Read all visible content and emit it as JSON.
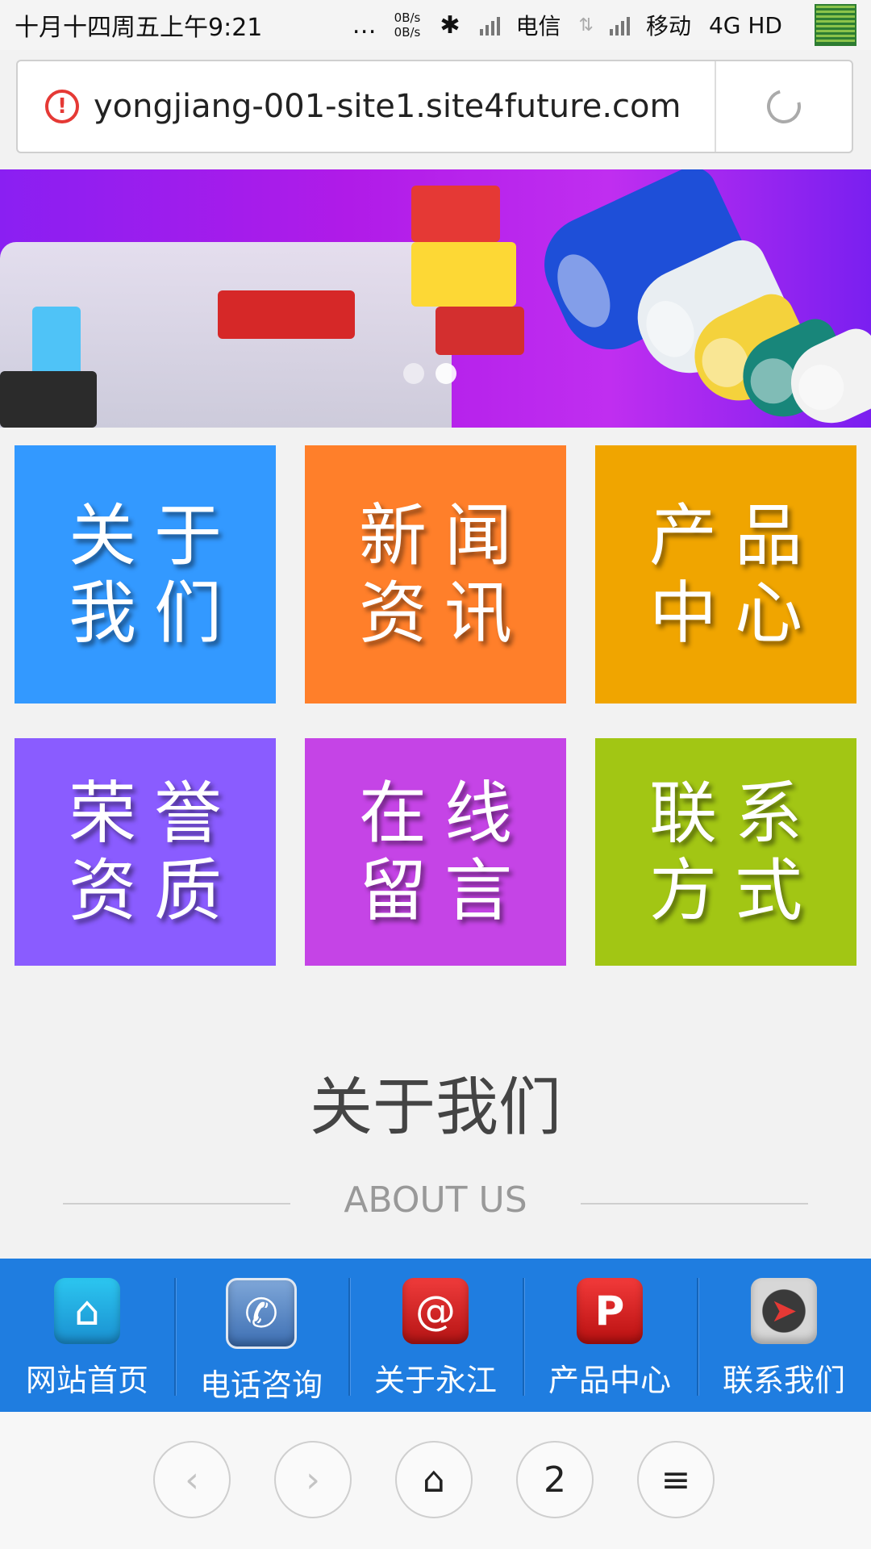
{
  "status_bar": {
    "time": "十月十四周五上午9:21",
    "net_speed_up": "0B/s",
    "net_speed_down": "0B/s",
    "carrier1": "电信",
    "carrier2": "移动",
    "network": "4G HD"
  },
  "browser": {
    "url": "yongjiang-001-site1.site4future.com",
    "tab_count": "2"
  },
  "banner": {
    "slides": 2,
    "active_slide": 1
  },
  "tiles": [
    {
      "label": "关于\n我们",
      "color": "#3399ff"
    },
    {
      "label": "新闻\n资讯",
      "color": "#ff7f2a"
    },
    {
      "label": "产品\n中心",
      "color": "#f0a500"
    },
    {
      "label": "荣誉\n资质",
      "color": "#8a5cff"
    },
    {
      "label": "在线\n留言",
      "color": "#c544e6"
    },
    {
      "label": "联系\n方式",
      "color": "#a2c614"
    }
  ],
  "section": {
    "title": "关于我们",
    "subtitle": "ABOUT US"
  },
  "bottom_nav": [
    {
      "label": "网站首页",
      "icon": "home-icon"
    },
    {
      "label": "电话咨询",
      "icon": "phone-icon"
    },
    {
      "label": "关于永江",
      "icon": "about-icon"
    },
    {
      "label": "产品中心",
      "icon": "product-icon"
    },
    {
      "label": "联系我们",
      "icon": "compass-icon"
    }
  ],
  "colors": {
    "nav_bg": "#1f7de0",
    "banner_bg": "#b01be8"
  }
}
